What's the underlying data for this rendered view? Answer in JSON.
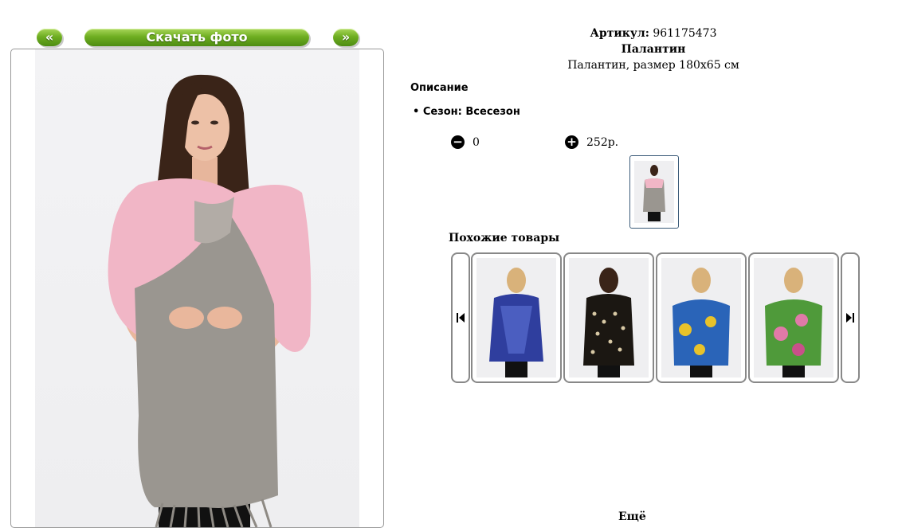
{
  "nav": {
    "prev_label": "«",
    "download_label": "Скачать фото",
    "next_label": "»"
  },
  "product": {
    "article_label": "Артикул:",
    "article_value": "961175473",
    "name": "Палантин",
    "subtitle": "Палантин, размер 180x65 см"
  },
  "description": {
    "title": "Описание",
    "season": "• Сезон: Всесезон"
  },
  "quantity": {
    "minus_icon": "minus-circle-icon",
    "value": "0",
    "plus_icon": "plus-circle-icon",
    "price": "252р."
  },
  "similar": {
    "title": "Похожие товары",
    "prev_icon": "skip-back-icon",
    "next_icon": "skip-forward-icon"
  },
  "footer_fragment": "Ещё",
  "colors": {
    "button_green": "#6fae22",
    "scarf_pink": "#f1b6c6",
    "scarf_grey": "#9a9690"
  }
}
